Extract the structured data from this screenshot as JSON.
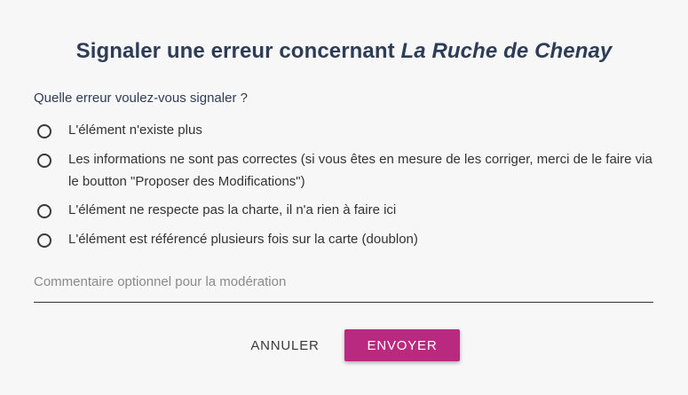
{
  "dialog": {
    "title_prefix": "Signaler une erreur concernant ",
    "title_element": "La Ruche de Chenay",
    "question": "Quelle erreur voulez-vous signaler ?",
    "options": [
      {
        "label": "L'élément n'existe plus"
      },
      {
        "label": "Les informations ne sont pas correctes (si vous êtes en mesure de les corriger, merci de le faire via le boutton \"Proposer des Modifications\")"
      },
      {
        "label": "L'élément ne respecte pas la charte, il n'a rien à faire ici"
      },
      {
        "label": "L'élément est référencé plusieurs fois sur la carte (doublon)"
      }
    ],
    "comment_placeholder": "Commentaire optionnel pour la modération",
    "comment_value": "",
    "cancel_label": "Annuler",
    "send_label": "Envoyer"
  },
  "colors": {
    "accent": "#b8297f",
    "title": "#2e3d57",
    "background": "#f7f7f7"
  }
}
